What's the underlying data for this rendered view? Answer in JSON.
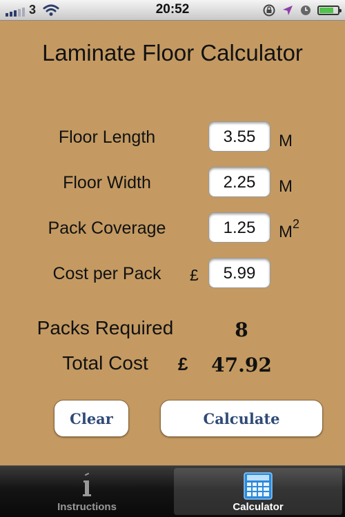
{
  "status_bar": {
    "carrier": "3",
    "time": "20:52",
    "battery_level": 0.85
  },
  "title": "Laminate Floor Calculator",
  "inputs": [
    {
      "label": "Floor Length",
      "currency": "",
      "value": "3.55",
      "unit": "M",
      "unit_sup": ""
    },
    {
      "label": "Floor Width",
      "currency": "",
      "value": "2.25",
      "unit": "M",
      "unit_sup": ""
    },
    {
      "label": "Pack Coverage",
      "currency": "",
      "value": "1.25",
      "unit": "M",
      "unit_sup": "2"
    },
    {
      "label": "Cost per Pack",
      "currency": "£",
      "value": "5.99",
      "unit": "",
      "unit_sup": ""
    }
  ],
  "results": {
    "packs_label": "Packs Required",
    "packs_value": "8",
    "cost_label": "Total Cost",
    "cost_currency": "£",
    "cost_value": "47.92"
  },
  "buttons": {
    "clear": "Clear",
    "calculate": "Calculate"
  },
  "tabs": [
    {
      "label": "Instructions",
      "icon": "info-icon",
      "active": false
    },
    {
      "label": "Calculator",
      "icon": "calculator-icon",
      "active": true
    }
  ],
  "colors": {
    "background": "#c49a62",
    "button_text": "#2f4a77"
  }
}
